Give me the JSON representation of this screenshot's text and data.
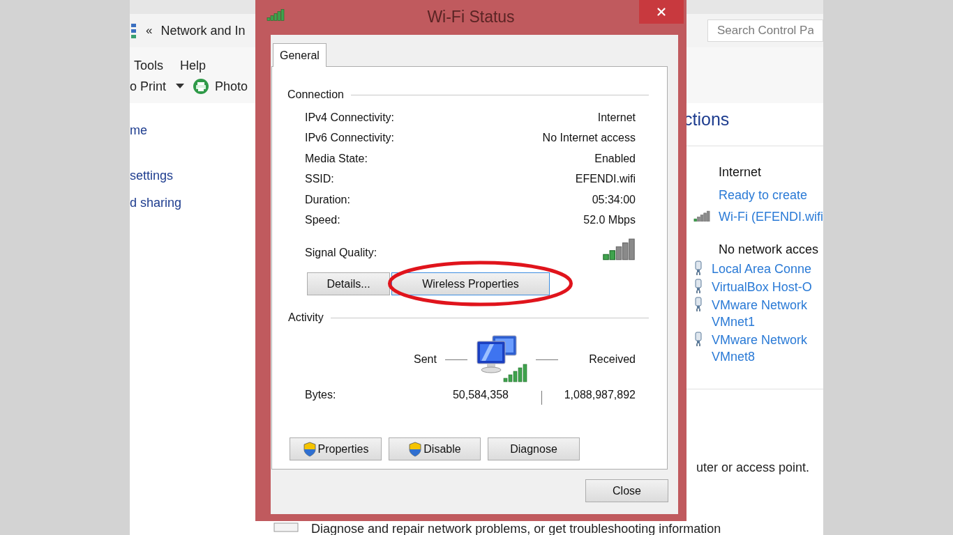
{
  "background_window": {
    "address": {
      "back": "«",
      "path": "Network and In"
    },
    "search": {
      "placeholder": "Search Control Pa"
    },
    "menu": [
      "Tools",
      "Help"
    ],
    "toolbar": {
      "print": "o Print",
      "photo": "Photo"
    },
    "left_nav": [
      "me",
      "settings",
      "d sharing"
    ],
    "heading": "ctions",
    "networks": [
      {
        "title": "Internet",
        "status": "Ready to create",
        "connections": [
          {
            "name": "Wi-Fi (EFENDI.wifi",
            "kind": "wireless"
          }
        ]
      },
      {
        "title": "No network acces",
        "connections": [
          {
            "name": "Local Area Conne",
            "kind": "wired"
          },
          {
            "name": "VirtualBox Host-O",
            "kind": "wired"
          },
          {
            "name": "VMware Network",
            "subname": "VMnet1",
            "kind": "wired"
          },
          {
            "name": "VMware Network",
            "subname": "VMnet8",
            "kind": "wired"
          }
        ]
      }
    ],
    "tasks": [
      "uter or access point.",
      "Diagnose and repair network problems, or get troubleshooting information"
    ]
  },
  "dialog": {
    "title": "Wi-Fi Status",
    "tabs": [
      {
        "label": "General",
        "selected": true
      }
    ],
    "connection": {
      "label": "Connection",
      "rows": [
        {
          "label": "IPv4 Connectivity:",
          "value": "Internet"
        },
        {
          "label": "IPv6 Connectivity:",
          "value": "No Internet access"
        },
        {
          "label": "Media State:",
          "value": "Enabled"
        },
        {
          "label": "SSID:",
          "value": "EFENDI.wifi"
        },
        {
          "label": "Duration:",
          "value": "05:34:00"
        },
        {
          "label": "Speed:",
          "value": "52.0 Mbps"
        }
      ],
      "signal_label": "Signal Quality:"
    },
    "buttons": [
      {
        "label": "Details...",
        "focused": false
      },
      {
        "label": "Wireless Properties",
        "focused": true
      }
    ],
    "activity": {
      "label": "Activity",
      "sent": "Sent",
      "received": "Received",
      "rows": [
        {
          "label": "Bytes:",
          "sent": "50,584,358",
          "received": "1,088,987,892"
        }
      ]
    },
    "action_buttons": [
      {
        "label": "Properties",
        "shield": true
      },
      {
        "label": "Disable",
        "shield": true
      },
      {
        "label": "Diagnose",
        "shield": false
      }
    ],
    "footer_button": "Close"
  }
}
